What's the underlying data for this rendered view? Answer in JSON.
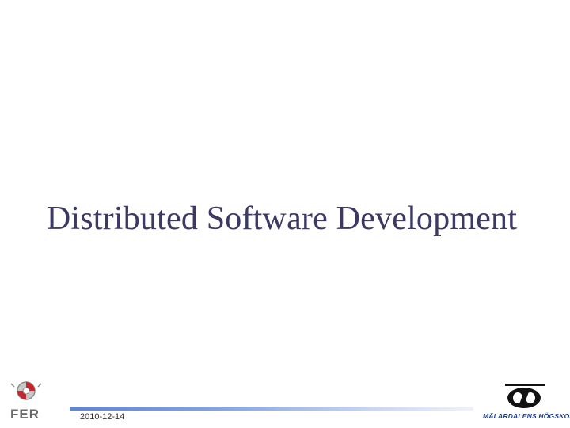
{
  "slide": {
    "title": "Distributed Software Development",
    "date": "2010-12-14"
  },
  "logos": {
    "left": {
      "icon": "fer-emblem-icon",
      "text": "FER"
    },
    "right": {
      "icon": "mdh-emblem-icon",
      "text": "MÄLARDALENS HÖGSKOLA"
    }
  },
  "colors": {
    "title": "#3c3a63",
    "footer_bar_start": "#5a86d8",
    "footer_bar_end": "#eef2fb",
    "mdh_blue": "#1c3f8c",
    "fer_red": "#c8262e"
  }
}
